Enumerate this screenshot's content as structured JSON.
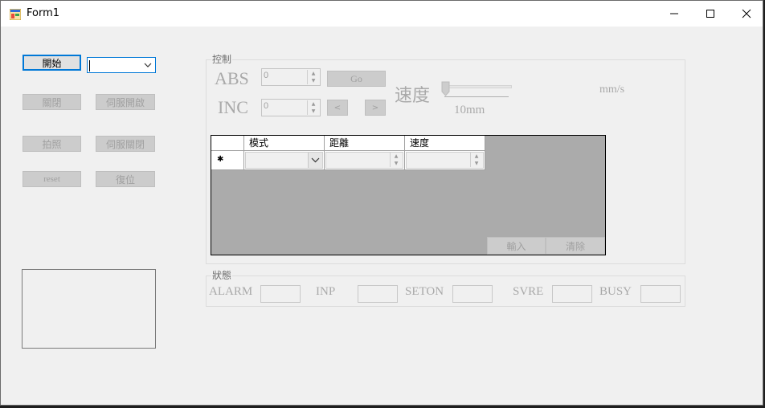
{
  "window": {
    "title": "Form1",
    "minimize": "—",
    "maximize": "☐",
    "close": "✕"
  },
  "left": {
    "start_label": "開始",
    "close_label": "關閉",
    "servo_on_label": "伺服開啟",
    "photo_label": "拍照",
    "servo_off_label": "伺服關閉",
    "reset_label": "reset",
    "restore_label": "復位",
    "port_value": ""
  },
  "control": {
    "group_label": "控制",
    "abs_label": "ABS",
    "inc_label": "INC",
    "abs_value": "0",
    "inc_value": "0",
    "go_label": "Go",
    "left_label": "<",
    "right_label": ">",
    "speed_label": "速度",
    "slider_value_label": "10mm",
    "unit_label": "mm/s",
    "slider_level": 0
  },
  "grid": {
    "columns": [
      "模式",
      "距離",
      "速度"
    ],
    "new_row_marker": "✱",
    "import_label": "輸入",
    "clear_label": "清除"
  },
  "status": {
    "group_label": "狀態",
    "items": [
      "ALARM",
      "INP",
      "SETON",
      "SVRE",
      "BUSY"
    ]
  }
}
